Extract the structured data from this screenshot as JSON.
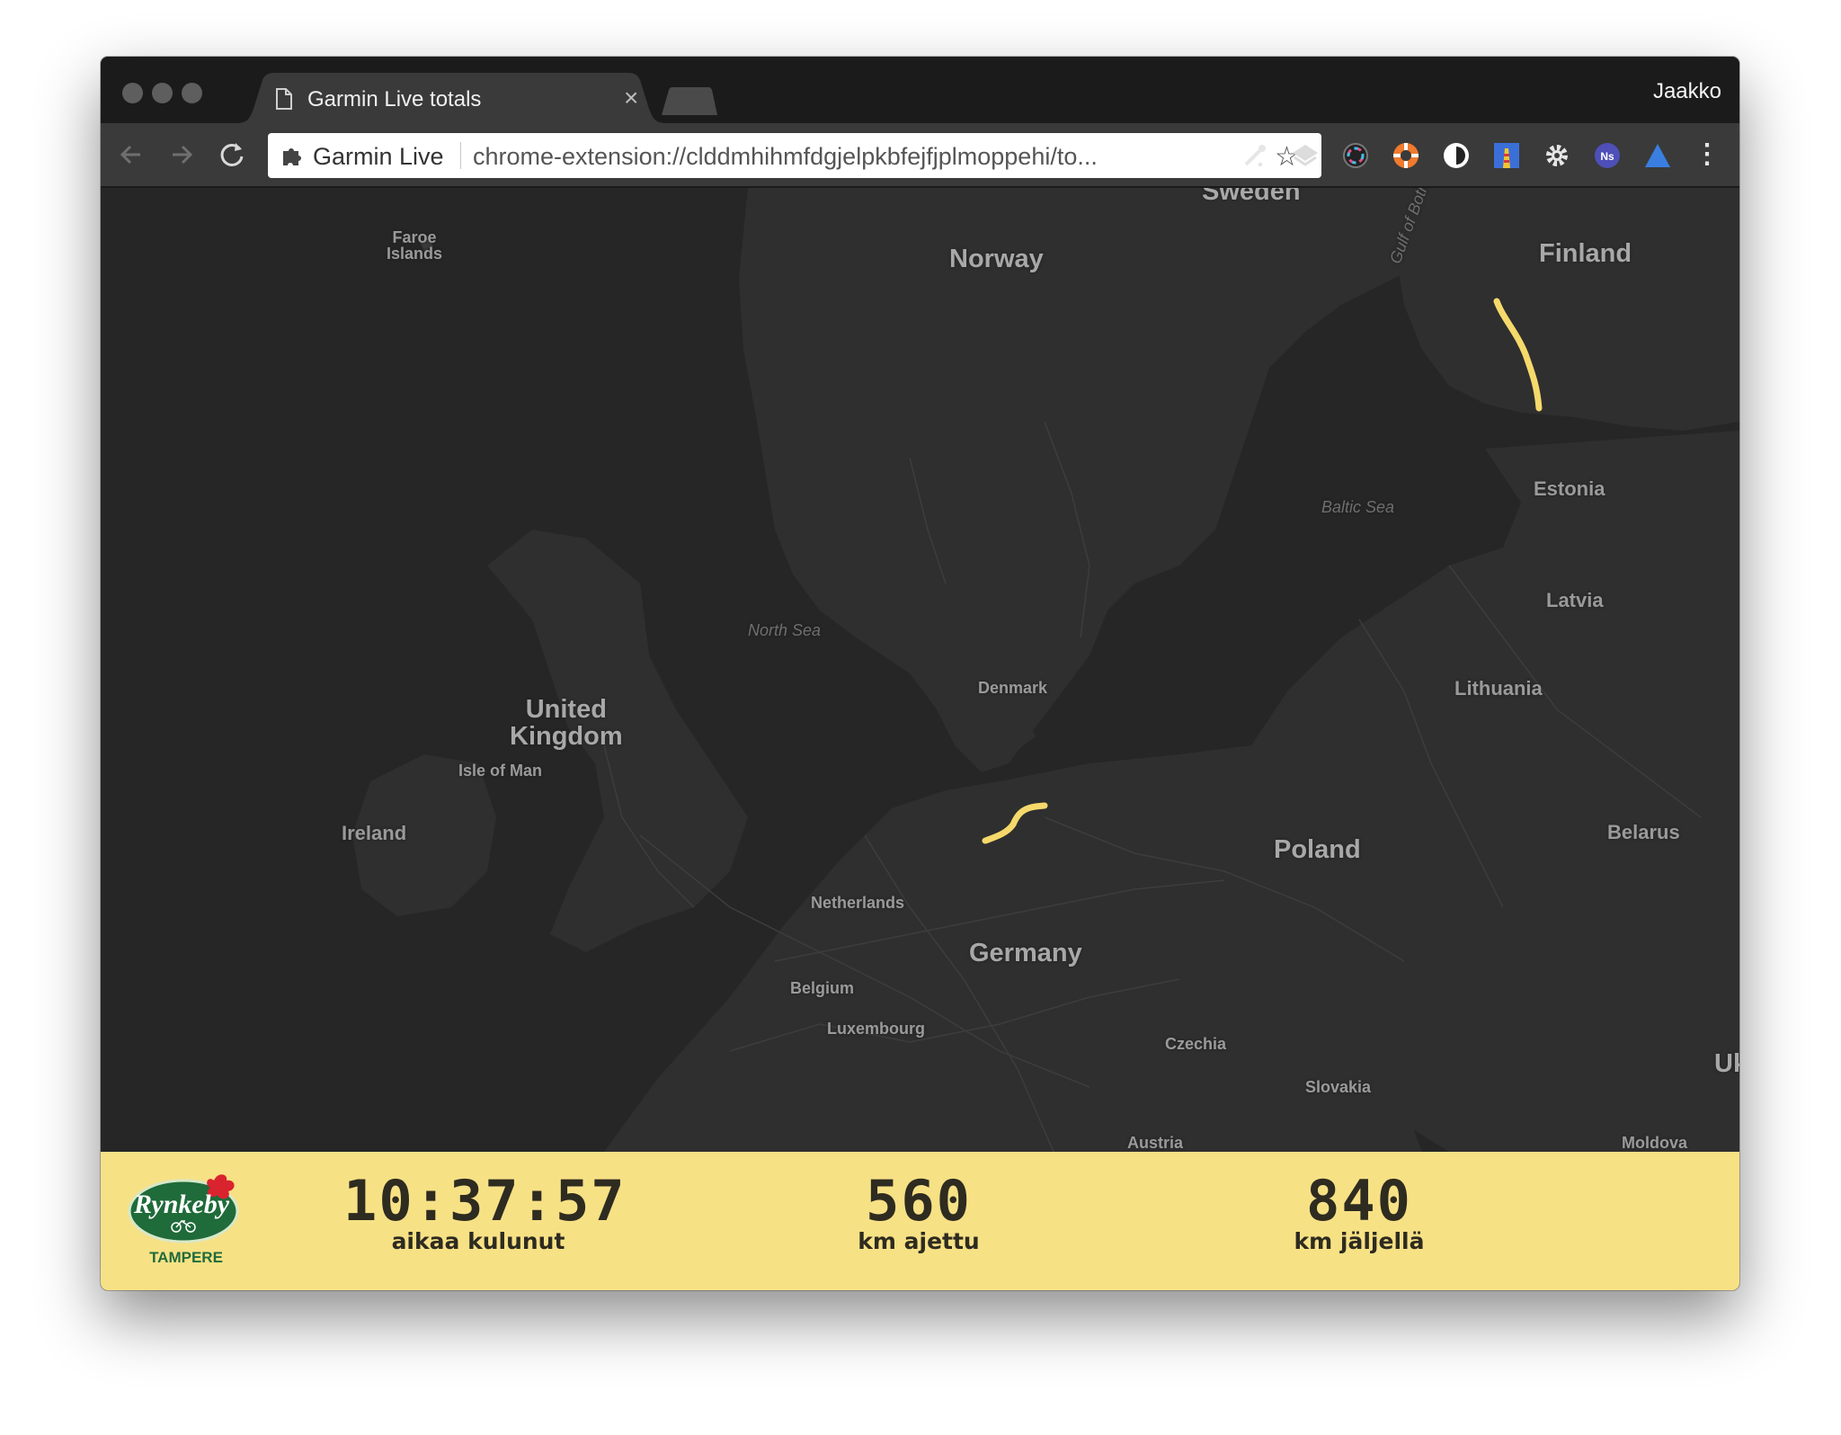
{
  "browser": {
    "tab_title": "Garmin Live totals",
    "tab_close": "×",
    "profile_name": "Jaakko",
    "omnibox_site": "Garmin Live",
    "omnibox_url": "chrome-extension://clddmhihmfdgjelpkbfejfjplmoppehi/to...",
    "star": "☆",
    "menu": "⋮"
  },
  "map": {
    "labels": {
      "sweden": "Sweden",
      "norway": "Norway",
      "finland": "Finland",
      "faroe": "Faroe\nIslands",
      "gulf_bothnia": "Gulf of Bothnia",
      "estonia": "Estonia",
      "baltic_sea": "Baltic Sea",
      "latvia": "Latvia",
      "north_sea": "North Sea",
      "lithuania": "Lithuania",
      "denmark": "Denmark",
      "united_kingdom": "United\nKingdom",
      "isle_of_man": "Isle of Man",
      "ireland": "Ireland",
      "poland": "Poland",
      "belarus": "Belarus",
      "netherlands": "Netherlands",
      "germany": "Germany",
      "belgium": "Belgium",
      "luxembourg": "Luxembourg",
      "czechia": "Czechia",
      "slovakia": "Slovakia",
      "austria": "Austria",
      "moldova": "Moldova",
      "ukraine_partial": "Uk"
    },
    "route_color": "#f5d96b"
  },
  "footer": {
    "logo_text": "Rynkeby",
    "logo_city": "TAMPERE",
    "elapsed_value": "10:37:57",
    "elapsed_label": "aikaa kulunut",
    "ridden_value": "560",
    "ridden_label": "km ajettu",
    "remaining_value": "840",
    "remaining_label": "km jäljellä"
  }
}
